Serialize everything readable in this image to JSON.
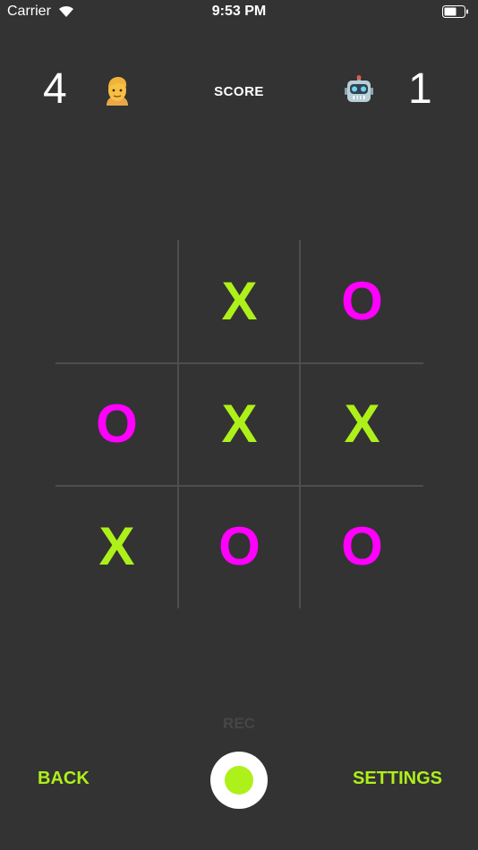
{
  "status_bar": {
    "carrier": "Carrier",
    "time": "9:53 PM",
    "wifi_icon": "wifi-icon",
    "battery_icon": "battery-icon"
  },
  "score": {
    "label": "SCORE",
    "player": {
      "value": "4",
      "avatar": "person-emoji"
    },
    "opponent": {
      "value": "1",
      "avatar": "robot-emoji"
    }
  },
  "board": {
    "cells": [
      "",
      "X",
      "O",
      "O",
      "X",
      "X",
      "X",
      "O",
      "O"
    ]
  },
  "controls": {
    "rec_label": "REC",
    "back_label": "BACK",
    "settings_label": "SETTINGS",
    "record_icon": "record-icon"
  },
  "colors": {
    "background": "#333333",
    "x_color": "#aef01a",
    "o_color": "#ff00ff",
    "grid": "#4e4e4e"
  }
}
